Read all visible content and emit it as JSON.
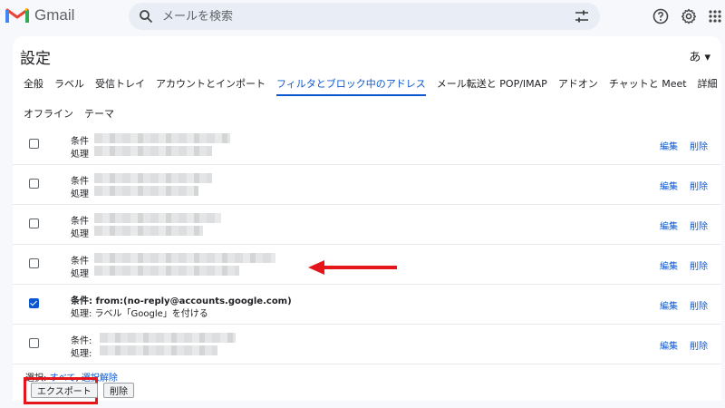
{
  "app": {
    "name": "Gmail"
  },
  "search": {
    "placeholder": "メールを検索"
  },
  "settings": {
    "title": "設定",
    "lang_label": "あ ▾",
    "tabs": [
      {
        "label": "全般"
      },
      {
        "label": "ラベル"
      },
      {
        "label": "受信トレイ"
      },
      {
        "label": "アカウントとインポート"
      },
      {
        "label": "フィルタとブロック中のアドレス"
      },
      {
        "label": "メール転送と POP/IMAP"
      },
      {
        "label": "アドオン"
      },
      {
        "label": "チャットと Meet"
      },
      {
        "label": "詳細"
      },
      {
        "label": "オフライン"
      },
      {
        "label": "テーマ"
      }
    ],
    "active_tab": "フィルタとブロック中のアドレス"
  },
  "filters": {
    "condition_label": "条件",
    "action_label": "処理",
    "edit_label": "編集",
    "delete_label": "削除",
    "highlighted": {
      "condition": "条件: from:(no-reply@accounts.google.com)",
      "action": "処理: ラベル「Google」を付ける"
    },
    "last": {
      "condition": "条件:",
      "action": "処理:"
    }
  },
  "footer": {
    "select_label": "選択:",
    "select_all": "すべて",
    "select_none": "選択解除",
    "export_button": "エクスポート",
    "delete_button": "削除"
  },
  "colors": {
    "accent": "#0b57d0",
    "highlight": "#e4161b"
  }
}
